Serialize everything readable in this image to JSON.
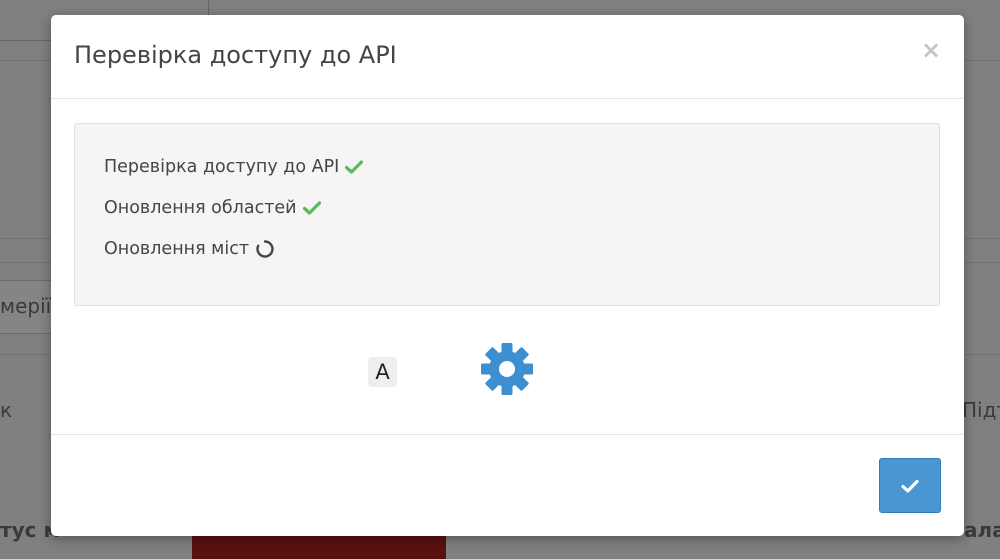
{
  "background": {
    "left_fragments": [
      "мерії!",
      "к",
      "тус м"
    ],
    "right_fragments": [
      "Підт",
      "ала"
    ]
  },
  "modal": {
    "title": "Перевірка доступу до API",
    "close_glyph": "×",
    "status_items": [
      {
        "label": "Перевірка доступу до API",
        "state": "done",
        "icon": "check-icon"
      },
      {
        "label": "Оновлення областей",
        "state": "done",
        "icon": "check-icon"
      },
      {
        "label": "Оновлення міст",
        "state": "loading",
        "icon": "spinner-icon"
      }
    ],
    "font_badge": "A",
    "gear_icon": "gear-icon",
    "confirm_icon": "check-icon"
  },
  "colors": {
    "success": "#5cb85c",
    "primary": "#4a96d2",
    "gear": "#3d8fd1"
  }
}
